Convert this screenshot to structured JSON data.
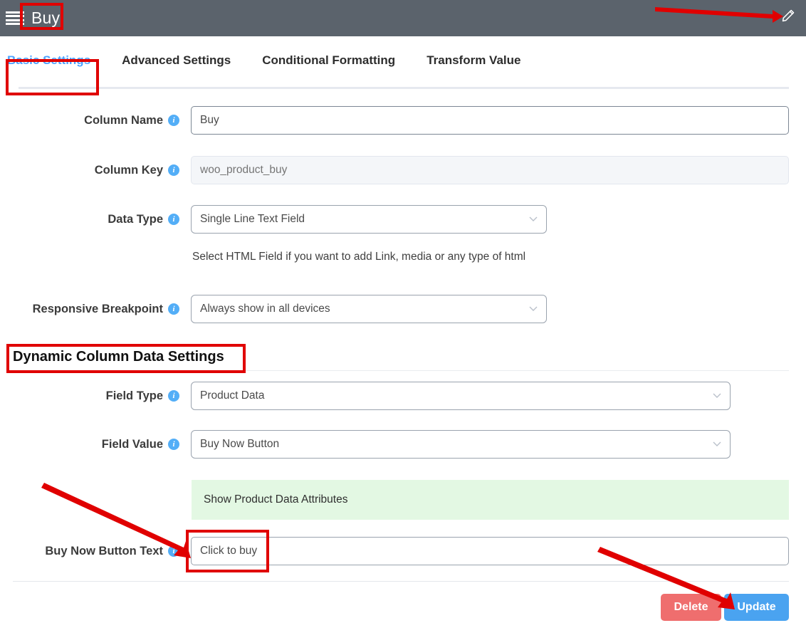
{
  "topbar": {
    "menu_icon": "hamburger-menu-icon",
    "title": "Buy",
    "edit_icon": "pencil-icon"
  },
  "tabs": [
    {
      "label": "Basic Settings",
      "active": true
    },
    {
      "label": "Advanced Settings",
      "active": false
    },
    {
      "label": "Conditional Formatting",
      "active": false
    },
    {
      "label": "Transform Value",
      "active": false
    }
  ],
  "form": {
    "column_name": {
      "label": "Column Name",
      "value": "Buy",
      "info_icon": "info-icon"
    },
    "column_key": {
      "label": "Column Key",
      "value": "woo_product_buy",
      "placeholder": "woo_product_buy",
      "info_icon": "info-icon"
    },
    "data_type": {
      "label": "Data Type",
      "value": "Single Line Text Field",
      "info_icon": "info-icon",
      "chevron_icon": "chevron-down-icon",
      "hint": "Select HTML Field if you want to add Link, media or any type of html"
    },
    "responsive_breakpoint": {
      "label": "Responsive Breakpoint",
      "value": "Always show in all devices",
      "info_icon": "info-icon",
      "chevron_icon": "chevron-down-icon"
    }
  },
  "dynamic_section": {
    "title": "Dynamic Column Data Settings",
    "field_type": {
      "label": "Field Type",
      "value": "Product Data",
      "info_icon": "info-icon",
      "chevron_icon": "chevron-down-icon"
    },
    "field_value": {
      "label": "Field Value",
      "value": "Buy Now Button",
      "info_icon": "info-icon",
      "chevron_icon": "chevron-down-icon"
    },
    "notice": "Show Product Data Attributes",
    "buy_now_button_text": {
      "label": "Buy Now Button Text",
      "value": "Click to buy",
      "info_icon": "info-icon"
    }
  },
  "footer": {
    "delete_label": "Delete",
    "update_label": "Update"
  },
  "colors": {
    "topbar_bg": "#5b636c",
    "tab_active": "#4da3ff",
    "info_icon": "#53aef7",
    "notice_bg": "#e3f8e3",
    "delete_btn": "#ef6e6e",
    "update_btn": "#4aa3f0",
    "annotation": "#e00000"
  }
}
